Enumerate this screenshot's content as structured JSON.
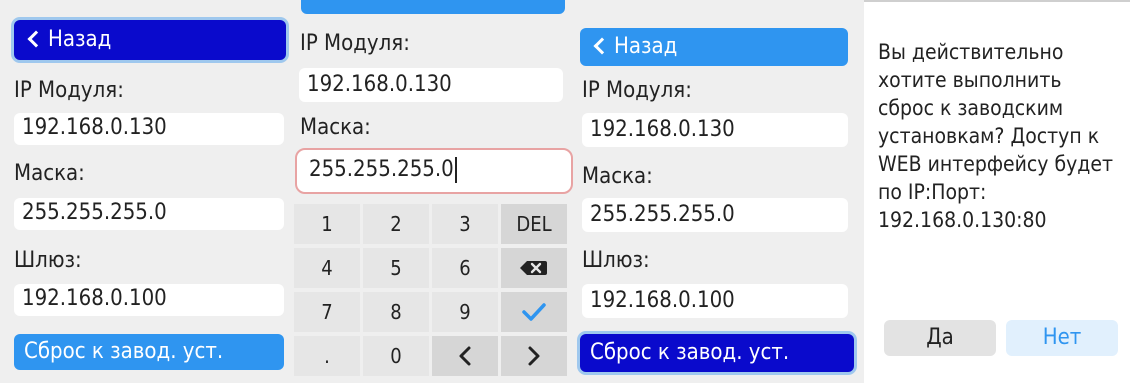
{
  "screen1": {
    "back_label": "Назад",
    "ip_label": "IP Модуля:",
    "ip_value": "192.168.0.130",
    "mask_label": "Маска:",
    "mask_value": "255.255.255.0",
    "gateway_label": "Шлюз:",
    "gateway_value": "192.168.0.100",
    "reset_label": "Сброс к завод. уст."
  },
  "screen2": {
    "ip_label": "IP Модуля:",
    "ip_value": "192.168.0.130",
    "mask_label": "Маска:",
    "mask_value": "255.255.255.0",
    "keypad": {
      "k1": "1",
      "k2": "2",
      "k3": "3",
      "del": "DEL",
      "k4": "4",
      "k5": "5",
      "k6": "6",
      "k7": "7",
      "k8": "8",
      "k9": "9",
      "dot": ".",
      "k0": "0"
    }
  },
  "screen3": {
    "back_label": "Назад",
    "ip_label": "IP Модуля:",
    "ip_value": "192.168.0.130",
    "mask_label": "Маска:",
    "mask_value": "255.255.255.0",
    "gateway_label": "Шлюз:",
    "gateway_value": "192.168.0.100",
    "reset_label": "Сброс к завод. уст."
  },
  "dialog": {
    "message": "Вы действительно хотите выполнить сброс к заводским установкам? Доступ к WEB интерфейсу будет по IP:Порт: 192.168.0.130:80",
    "yes_label": "Да",
    "no_label": "Нет"
  },
  "colors": {
    "dark_button": "#0a0acc",
    "light_button": "#2f95f0",
    "focus_ring": "#9fc8ee",
    "active_field_border": "#e8a3a3",
    "check_icon": "#2f95f0"
  }
}
